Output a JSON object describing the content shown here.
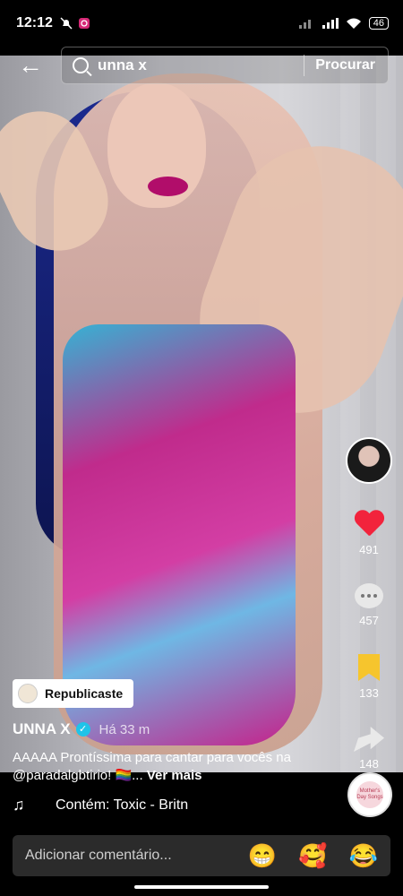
{
  "status_bar": {
    "time": "12:12",
    "battery": "46"
  },
  "search": {
    "query": "unna x",
    "submit_label": "Procurar"
  },
  "video": {
    "author": "UNNA X",
    "time_ago": "Há 33 m",
    "caption": "AAAAA Prontíssima para cantar para vocês na @paradalgbtirio! 🏳️‍🌈...",
    "more_label": "Ver mais",
    "repost_label": "Republicaste",
    "sound": "Contém: Toxic - Britn"
  },
  "actions": {
    "likes": "491",
    "comments": "457",
    "saves": "133",
    "shares": "148"
  },
  "music_disc_text": "Mother's Day Songs",
  "comment_bar": {
    "placeholder": "Adicionar comentário...",
    "emojis": [
      "😁",
      "🥰",
      "😂"
    ]
  },
  "colors": {
    "like": "#f2233c",
    "save": "#f6c52d",
    "verified": "#20c3e8"
  }
}
